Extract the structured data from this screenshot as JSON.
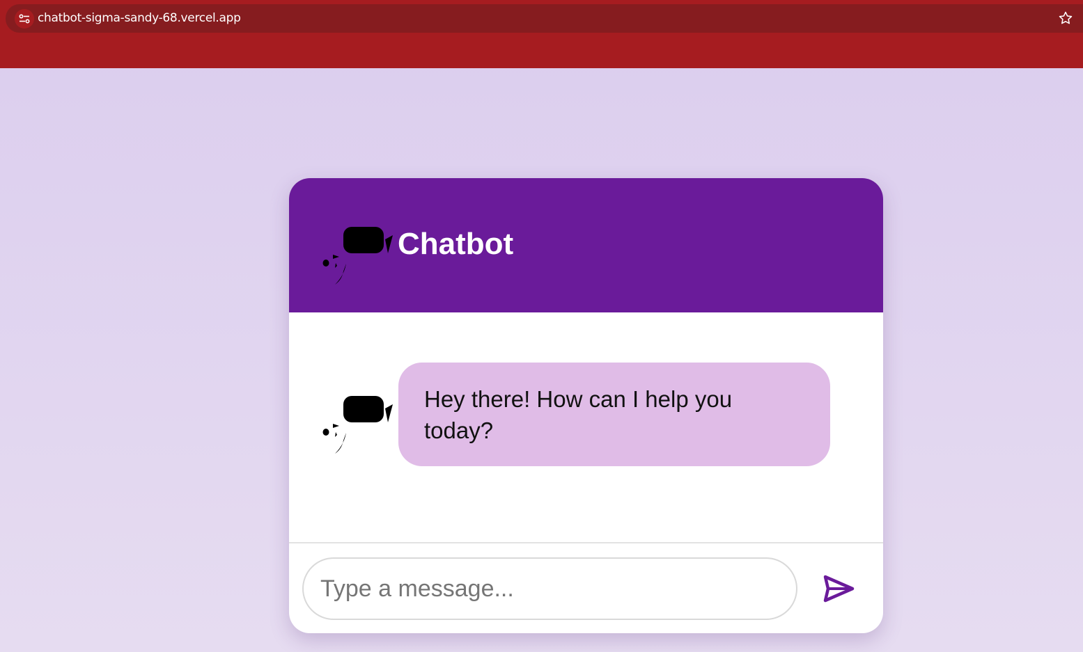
{
  "browser": {
    "url": "chatbot-sigma-sandy-68.vercel.app"
  },
  "header": {
    "title": "Chatbot",
    "logo_icon": "chatbot-logo-icon"
  },
  "messages": [
    {
      "sender": "bot",
      "avatar_icon": "chatbot-avatar-icon",
      "text": "Hey there! How can I help you today?"
    }
  ],
  "composer": {
    "placeholder": "Type a message...",
    "value": "",
    "send_icon": "send-icon"
  },
  "colors": {
    "accent": "#6a1b9a",
    "bubble": "#e0bce7",
    "browser_bar": "#a61c20"
  }
}
